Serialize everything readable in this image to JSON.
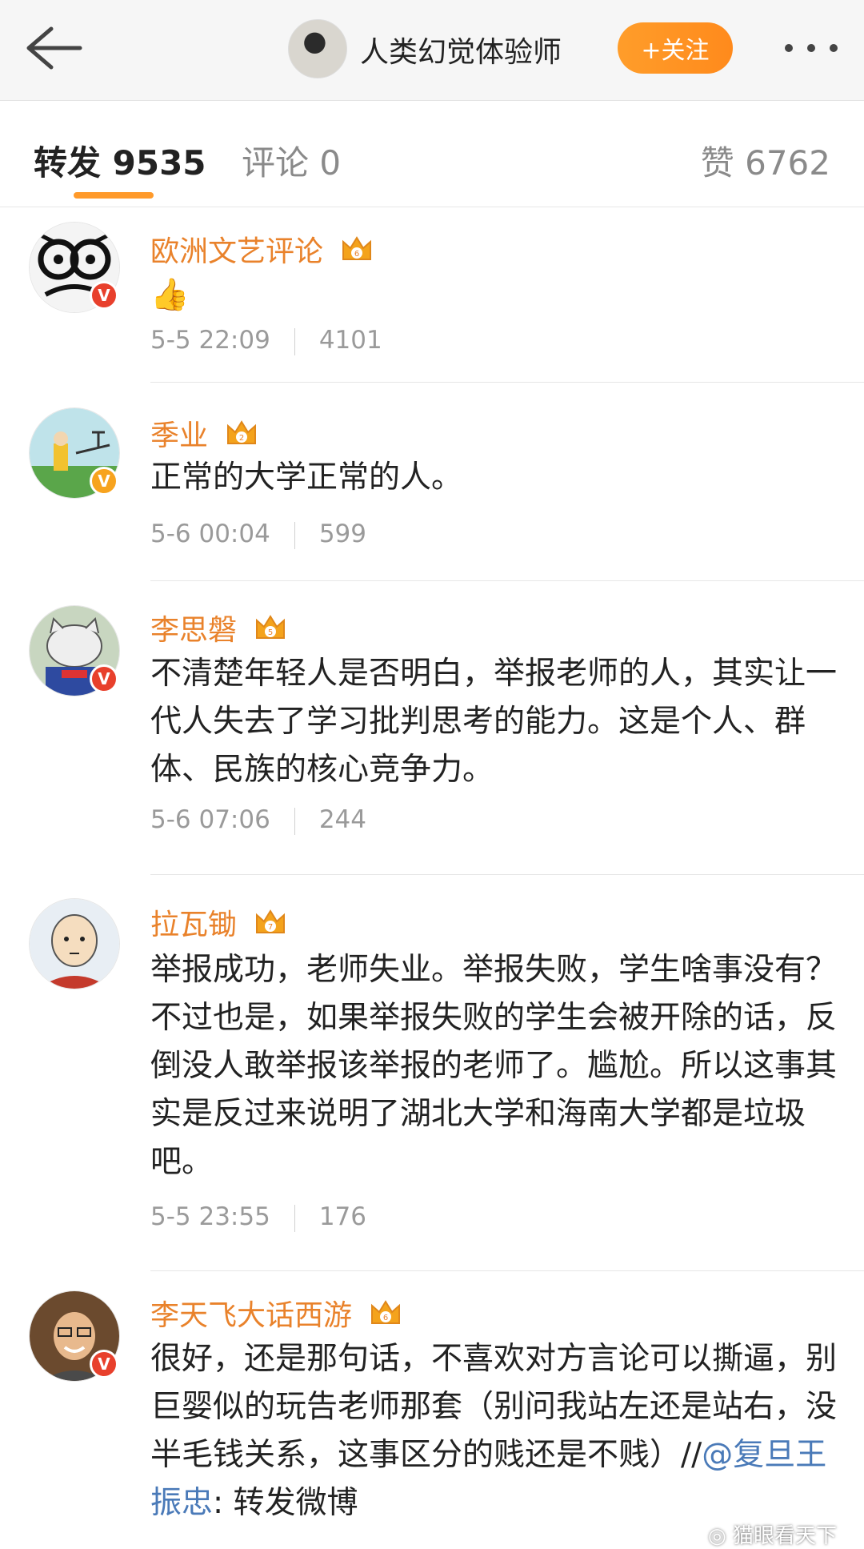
{
  "header": {
    "title": "人类幻觉体验师",
    "follow_label": "+关注"
  },
  "tabs": {
    "repost": "转发 9535",
    "comment": "评论 0",
    "like": "赞 6762"
  },
  "reposts": [
    {
      "name": "欧洲文艺评论",
      "level": "6",
      "content": "👍",
      "time": "5-5 22:09",
      "likes": "4101",
      "badge": "red"
    },
    {
      "name": "季业",
      "level": "2",
      "content": "正常的大学正常的人。",
      "time": "5-6 00:04",
      "likes": "599",
      "badge": "gold"
    },
    {
      "name": "李思磐",
      "level": "5",
      "content": "不清楚年轻人是否明白，举报老师的人，其实让一代人失去了学习批判思考的能力。这是个人、群体、民族的核心竞争力。",
      "time": "5-6 07:06",
      "likes": "244",
      "badge": "red"
    },
    {
      "name": "拉瓦锄",
      "level": "7",
      "content": "举报成功，老师失业。举报失败，学生啥事没有？不过也是，如果举报失败的学生会被开除的话，反倒没人敢举报该举报的老师了。尴尬。所以这事其实是反过来说明了湖北大学和海南大学都是垃圾吧。",
      "time": "5-5 23:55",
      "likes": "176",
      "badge": "none"
    },
    {
      "name": "李天飞大话西游",
      "level": "6",
      "content_text": "很好，还是那句话，不喜欢对方言论可以撕逼，别巨婴似的玩告老师那套（别问我站左还是站右，没半毛钱关系，这事区分的贱还是不贱）//",
      "mention": "@复旦王振忠",
      "content_tail": ": 转发微博",
      "badge": "red"
    }
  ],
  "watermark": "猫眼看天下",
  "colors": {
    "accent": "#ff9a2a",
    "username": "#e9822b",
    "mention": "#4a7ab8"
  }
}
